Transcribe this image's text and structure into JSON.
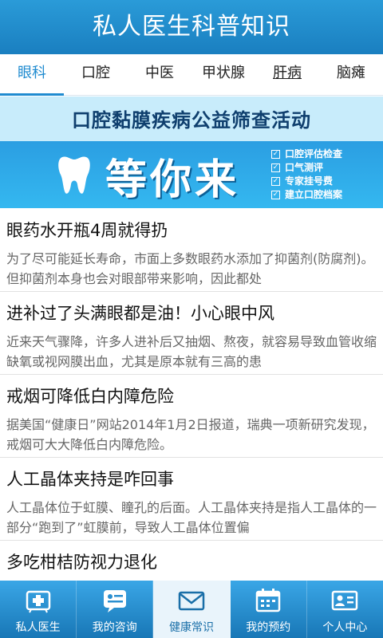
{
  "app": {
    "title": "私人医生科普知识"
  },
  "tabs": [
    {
      "label": "眼科"
    },
    {
      "label": "口腔"
    },
    {
      "label": "中医"
    },
    {
      "label": "甲状腺"
    },
    {
      "label": "肝病"
    },
    {
      "label": "脑瘫"
    }
  ],
  "banner": {
    "title": "口腔黏膜疾病公益筛查活动",
    "big_text": "等你来",
    "checklist": [
      "口腔评估检查",
      "口气测评",
      "专家挂号费",
      "建立口腔档案"
    ]
  },
  "articles": [
    {
      "title": "眼药水开瓶4周就得扔",
      "summary": "为了尽可能延长寿命，市面上多数眼药水添加了抑菌剂(防腐剂)。但抑菌剂本身也会对眼部带来影响，因此都处"
    },
    {
      "title": "进补过了头满眼都是油！小心眼中风",
      "summary": "近来天气骤降，许多人进补后又抽烟、熬夜，就容易导致血管收缩缺氧或视网膜出血，尤其是原本就有三高的患"
    },
    {
      "title": "戒烟可降低白内障危险",
      "summary": "据美国“健康日”网站2014年1月2日报道，瑞典一项新研究发现，戒烟可大大降低白内障危险。"
    },
    {
      "title": "人工晶体夹持是咋回事",
      "summary": "人工晶体位于虹膜、瞳孔的后面。人工晶体夹持是指人工晶体的一部分“跑到了”虹膜前，导致人工晶体位置偏"
    },
    {
      "title": "多吃柑桔防视力退化",
      "summary": ""
    }
  ],
  "bottom_nav": [
    {
      "label": "私人医生",
      "icon": "medical-kit-icon"
    },
    {
      "label": "我的咨询",
      "icon": "consult-chat-icon"
    },
    {
      "label": "健康常识",
      "icon": "mail-icon"
    },
    {
      "label": "我的预约",
      "icon": "calendar-icon"
    },
    {
      "label": "个人中心",
      "icon": "id-card-icon"
    }
  ],
  "colors": {
    "primary": "#1f8bd0",
    "titlebar": "#2a9bd8",
    "nav_active_bg": "#e9f4fb",
    "banner_light": "#c8ecfb",
    "banner_dark": "#2b9ee2"
  }
}
